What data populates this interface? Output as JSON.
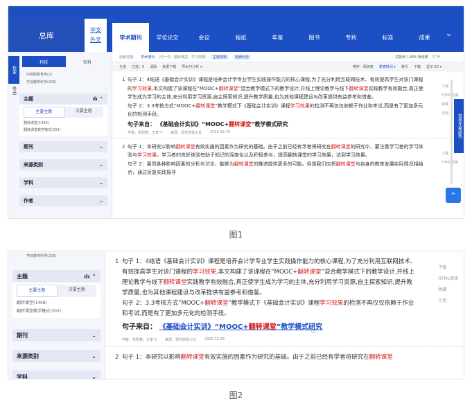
{
  "nav": {
    "home": "总库",
    "lang_cn": "中文",
    "lang_en": "外文",
    "items": [
      "学术期刊",
      "学位论文",
      "会议",
      "报纸",
      "年鉴",
      "图书",
      "专利",
      "标准",
      "成果"
    ]
  },
  "sidebar": {
    "vert_active": "检索",
    "vert_other": "导出",
    "tab_active": "科技",
    "tab_other": "社科",
    "pre_items": [
      "中高职教育学(2)",
      "学前教育科学(205)"
    ],
    "facet_main": "主题",
    "facet_main_icon": "chart-icon",
    "subtab_main": "主要主题",
    "subtab_sub": "次要主题",
    "topic_items": [
      "翻转课堂(1468)",
      "翻转课堂教学模式(303)"
    ],
    "facets": [
      "期刊",
      "来源类别",
      "学科",
      "作者"
    ]
  },
  "main": {
    "crumbs_label": "检索范围：",
    "crumbs_scope": "学术期刊",
    "crumbs_query": "(句一句：翻转课堂，学习效果)",
    "crumbs_chip1": "主题定制",
    "crumbs_chip2": "检索历史",
    "meta_total": "共找到 1,656 条结果",
    "meta_page": "1/34",
    "toolbar": {
      "select_all": "全选",
      "selected": "已选：0",
      "clear": "清除",
      "batch": "批量下载",
      "export": "导出与分析 ▾",
      "sort_label": "排序：相关度",
      "sort_pub": "发表时间 ▾",
      "sort_cite": "被引",
      "sort_dl": "下载",
      "show": "显示 20 ▾"
    },
    "results": [
      {
        "num": "1",
        "sentence1_pre": "句子 1：4结语《基础会计实训》课程是培养会计学专业学生实践操作能力的核心课程,为了充分利用互联网技术、有效提高学生对该门课程的",
        "sentence1_hl1": "学习效果",
        "sentence1_mid": ",本文构建了该课程在“MOOC+",
        "sentence1_hl2": "翻转课堂",
        "sentence1_mid2": "”混合教学模式下的教学设计,并线上理论教学与线下",
        "sentence1_hl3": "翻转课堂",
        "sentence1_post": "实践教学有效融合,真正使学生成为学习的主体,充分利用学习资源,自主探索知识,提升教学质量,也为其他课程建设与改革提供有益参考和借鉴。",
        "sentence2_pre": "句子 2：3.3考核方式“MOOC+",
        "sentence2_hl1": "翻转课堂",
        "sentence2_mid": "”教学模式下《基础会计实训》课程",
        "sentence2_hl2": "学习效果",
        "sentence2_post": "的检测不再仅仅依赖于作业和考试,而是有了更加多元化的检测手段。",
        "source_label": "句子来自：",
        "source_title_pre": "《基础会计实训》“MOOC+",
        "source_title_hl": "翻转课堂",
        "source_title_post": "”教学模式研究",
        "author_label": "作者：",
        "author": "张则宽；王家飞",
        "journal_label": "来源：",
        "journal": "现代商贸工业",
        "date": "2020-12-16",
        "actions": [
          "下载",
          "HTML阅读",
          "收藏",
          "引用"
        ]
      },
      {
        "num": "2",
        "sentence1_pre": "句子 1：本研究以影响",
        "sentence1_hl1": "翻转课堂",
        "sentence1_mid": "有效实施的因素作为研究的基础。由于之前已经有学者将研究在",
        "sentence1_hl2": "翻转课堂",
        "sentence1_mid2": "的研究中，要注重学习者的学习体验与",
        "sentence1_hl3": "学习效果",
        "sentence1_post": "。学习者的良好体验有助于知识的深度化以及积极参与，提高翻转课堂的学习效果，达到学习效果。",
        "sentence2_pre": "句子 2：虽然各种影响因素的分析与讨论，能够为",
        "sentence2_hl1": "翻转课堂",
        "sentence2_mid": "的推进提供更多的可能。但是我们应将",
        "sentence2_hl2": "翻转课堂",
        "sentence2_post": "与自身的教育发展实际情况相结合，通过反复实践探寻",
        "actions": [
          "下载",
          "HTML阅读"
        ]
      }
    ]
  },
  "float_tab": "发表年度趋势",
  "up_icon": "arrow-up-icon",
  "captions": [
    "图1",
    "图2"
  ],
  "zoom": {
    "pre_item": "学前教育科学(205)"
  },
  "colors": {
    "brand": "#1c4fc4",
    "highlight": "#d41c1c"
  }
}
